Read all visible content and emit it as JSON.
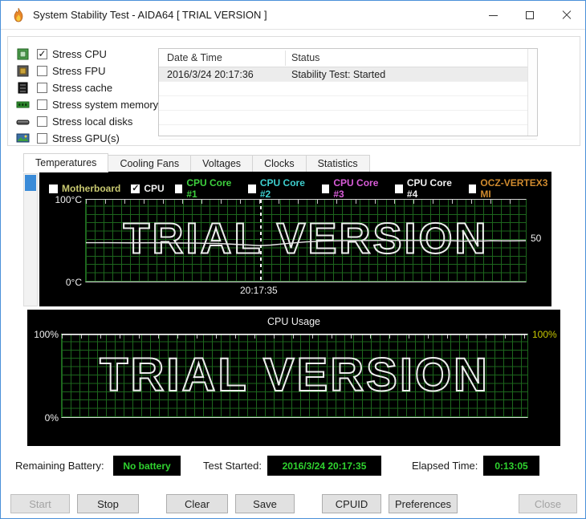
{
  "window": {
    "title": "System Stability Test - AIDA64  [ TRIAL VERSION ]"
  },
  "stress_options": [
    {
      "label": "Stress CPU",
      "check": "✓",
      "icon": "cpu-icon"
    },
    {
      "label": "Stress FPU",
      "check": "",
      "icon": "fpu-icon"
    },
    {
      "label": "Stress cache",
      "check": "",
      "icon": "cache-icon"
    },
    {
      "label": "Stress system memory",
      "check": "",
      "icon": "memory-icon"
    },
    {
      "label": "Stress local disks",
      "check": "",
      "icon": "disk-icon"
    },
    {
      "label": "Stress GPU(s)",
      "check": "",
      "icon": "gpu-icon"
    }
  ],
  "event_log": {
    "columns": [
      "Date & Time",
      "Status"
    ],
    "rows": [
      {
        "datetime": "2016/3/24 20:17:36",
        "status": "Stability Test: Started"
      }
    ]
  },
  "tabs": [
    {
      "label": "Temperatures",
      "active": true
    },
    {
      "label": "Cooling Fans",
      "active": false
    },
    {
      "label": "Voltages",
      "active": false
    },
    {
      "label": "Clocks",
      "active": false
    },
    {
      "label": "Statistics",
      "active": false
    }
  ],
  "temperature_graph": {
    "legend": [
      {
        "label": "Motherboard",
        "color": "#c8c870",
        "check": ""
      },
      {
        "label": "CPU",
        "color": "#f0f0f0",
        "check": "✓"
      },
      {
        "label": "CPU Core #1",
        "color": "#3ed13e",
        "check": ""
      },
      {
        "label": "CPU Core #2",
        "color": "#3ecfcf",
        "check": ""
      },
      {
        "label": "CPU Core #3",
        "color": "#d95cd9",
        "check": ""
      },
      {
        "label": "CPU Core #4",
        "color": "#f0f0f0",
        "check": ""
      },
      {
        "label": "OCZ-VERTEX3 MI",
        "color": "#cf8a2e",
        "check": ""
      }
    ],
    "y_top": "100°C",
    "y_bottom": "0°C",
    "time_marker": "20:17:35",
    "value_label": "50",
    "watermark": "TRIAL VERSION"
  },
  "usage_graph": {
    "title": "CPU Usage",
    "left_top": "100%",
    "right_top": "100%",
    "left_bottom": "0%",
    "right_top_color": "#c9c900",
    "watermark": "TRIAL VERSION"
  },
  "status_bar": {
    "battery_label": "Remaining Battery:",
    "battery_value": "No battery",
    "test_started_label": "Test Started:",
    "test_started_value": "2016/3/24 20:17:35",
    "elapsed_label": "Elapsed Time:",
    "elapsed_value": "0:13:05"
  },
  "buttons": [
    {
      "label": "Start",
      "enabled": false
    },
    {
      "label": "Stop",
      "enabled": true
    },
    {
      "label": "Clear",
      "enabled": true
    },
    {
      "label": "Save",
      "enabled": true
    },
    {
      "label": "CPUID",
      "enabled": true
    },
    {
      "label": "Preferences",
      "enabled": true
    },
    {
      "label": "Close",
      "enabled": false
    }
  ],
  "colors": {
    "window_border": "#4a90d9",
    "grid_green": "#1d661d",
    "led_green": "#2fd32f",
    "scroll_thumb_blue": "#3a8bd8"
  },
  "chart_data": [
    {
      "type": "line",
      "title": "CPU temperature (°C)",
      "ylim": [
        0,
        100
      ],
      "y_axis_labels": [
        "100°C",
        "0°C"
      ],
      "time_marker": "20:17:35",
      "last_value": 50,
      "series": [
        {
          "name": "CPU",
          "points": [
            [
              0,
              47.5
            ],
            [
              0.05,
              47.5
            ],
            [
              0.1,
              47.3
            ],
            [
              0.15,
              47.4
            ],
            [
              0.2,
              47.2
            ],
            [
              0.25,
              47.0
            ],
            [
              0.3,
              46.5
            ],
            [
              0.35,
              45.2
            ],
            [
              0.395,
              44.0
            ],
            [
              0.42,
              44.6
            ],
            [
              0.46,
              46.6
            ],
            [
              0.5,
              48.5
            ],
            [
              0.54,
              49.5
            ],
            [
              0.58,
              50.0
            ],
            [
              0.65,
              50.2
            ],
            [
              0.75,
              50.2
            ],
            [
              0.8,
              50.2
            ],
            [
              0.83,
              50.0
            ],
            [
              0.86,
              49.4
            ],
            [
              0.88,
              50.0
            ],
            [
              0.9,
              49.5
            ],
            [
              0.92,
              50.0
            ],
            [
              0.95,
              49.7
            ],
            [
              1.0,
              50.0
            ]
          ]
        }
      ]
    },
    {
      "type": "line",
      "title": "CPU Usage",
      "ylim": [
        0,
        100
      ],
      "y_axis_labels": [
        "100%",
        "0%"
      ],
      "series": [
        {
          "name": "CPU Usage",
          "points": [
            [
              0,
              100
            ],
            [
              1,
              100
            ]
          ]
        }
      ]
    }
  ]
}
